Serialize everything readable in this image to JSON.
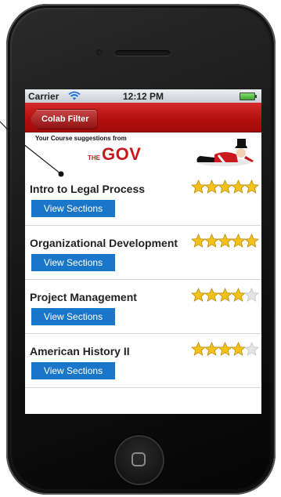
{
  "status_bar": {
    "carrier": "Carrier",
    "time": "12:12 PM"
  },
  "nav": {
    "back_label": "Colab Filter"
  },
  "banner": {
    "text": "Your Course suggestions from",
    "logo_prefix": "THE",
    "logo_main": "GOV"
  },
  "courses": [
    {
      "title": "Intro to Legal Process",
      "button_label": "View Sections",
      "rating": 5
    },
    {
      "title": "Organizational Development",
      "button_label": "View Sections",
      "rating": 5
    },
    {
      "title": "Project Management",
      "button_label": "View Sections",
      "rating": 4
    },
    {
      "title": "American History II",
      "button_label": "View Sections",
      "rating": 4
    }
  ],
  "rating_max": 5,
  "colors": {
    "nav_red": "#b50f0f",
    "button_blue": "#1976c8",
    "star_gold": "#f2c21b",
    "star_empty": "#e3e3e3",
    "logo_red": "#c8191e"
  }
}
